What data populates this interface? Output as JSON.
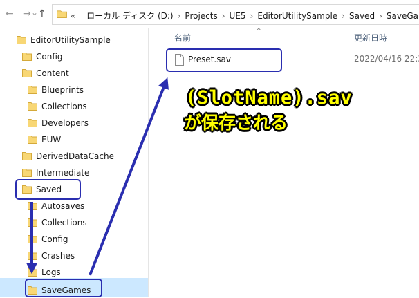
{
  "address": {
    "back_glyph": "←",
    "forward_glyph": "→",
    "recent_glyph": "⌄",
    "up_glyph": "↑",
    "overflow": "«",
    "crumbs": [
      "ローカル ディスク (D:)",
      "Projects",
      "UE5",
      "EditorUtilitySample",
      "Saved",
      "SaveGames"
    ]
  },
  "tree": [
    {
      "label": "EditorUtilitySample",
      "level": 0
    },
    {
      "label": "Config",
      "level": 1
    },
    {
      "label": "Content",
      "level": 1
    },
    {
      "label": "Blueprints",
      "level": 2
    },
    {
      "label": "Collections",
      "level": 2
    },
    {
      "label": "Developers",
      "level": 2
    },
    {
      "label": "EUW",
      "level": 2
    },
    {
      "label": "DerivedDataCache",
      "level": 1
    },
    {
      "label": "Intermediate",
      "level": 1
    },
    {
      "label": "Saved",
      "level": 1
    },
    {
      "label": "Autosaves",
      "level": 2
    },
    {
      "label": "Collections",
      "level": 2
    },
    {
      "label": "Config",
      "level": 2
    },
    {
      "label": "Crashes",
      "level": 2
    },
    {
      "label": "Logs",
      "level": 2
    },
    {
      "label": "SaveGames",
      "level": 2
    }
  ],
  "selected_index": 15,
  "columns": {
    "name": "名前",
    "date": "更新日時"
  },
  "file": {
    "name": "Preset.sav",
    "date": "2022/04/16 22:39"
  },
  "annotation": {
    "line1": "(SlotName).sav",
    "line2": "が保存される"
  },
  "colors": {
    "accent": "#2a2eb0",
    "callout_text": "#ffff00",
    "selection": "#cce8ff",
    "folder": "#f8d775"
  }
}
